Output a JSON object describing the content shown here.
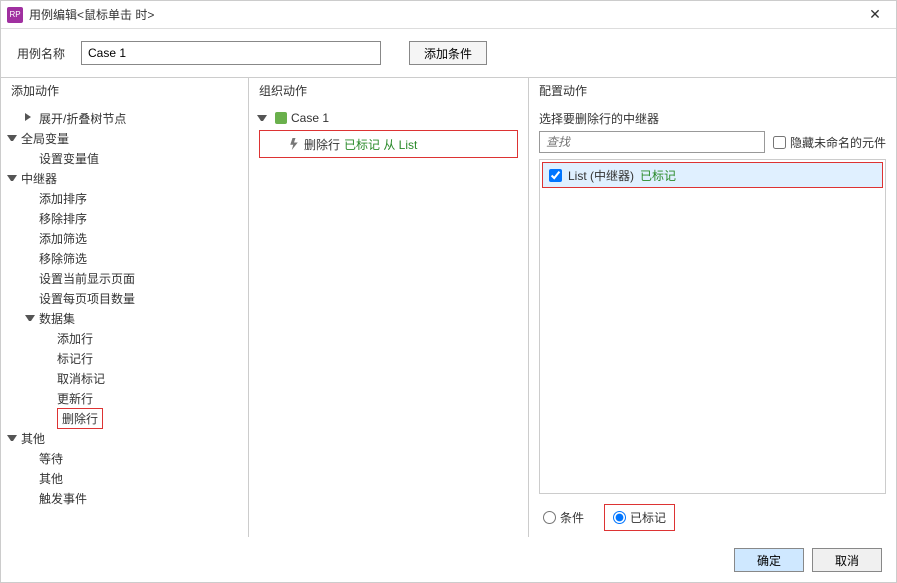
{
  "title": "用例编辑<鼠标单击 时>",
  "nameLabel": "用例名称",
  "nameValue": "Case 1",
  "addCondition": "添加条件",
  "columns": {
    "addAction": "添加动作",
    "organizeAction": "组织动作",
    "configAction": "配置动作"
  },
  "actionTree": [
    {
      "label": "展开/折叠树节点",
      "indent": 1,
      "arrow": "right"
    },
    {
      "label": "全局变量",
      "indent": 0,
      "arrow": "down"
    },
    {
      "label": "设置变量值",
      "indent": 1,
      "arrow": ""
    },
    {
      "label": "中继器",
      "indent": 0,
      "arrow": "down"
    },
    {
      "label": "添加排序",
      "indent": 1,
      "arrow": ""
    },
    {
      "label": "移除排序",
      "indent": 1,
      "arrow": ""
    },
    {
      "label": "添加筛选",
      "indent": 1,
      "arrow": ""
    },
    {
      "label": "移除筛选",
      "indent": 1,
      "arrow": ""
    },
    {
      "label": "设置当前显示页面",
      "indent": 1,
      "arrow": ""
    },
    {
      "label": "设置每页项目数量",
      "indent": 1,
      "arrow": ""
    },
    {
      "label": "数据集",
      "indent": 1,
      "arrow": "down"
    },
    {
      "label": "添加行",
      "indent": 2,
      "arrow": ""
    },
    {
      "label": "标记行",
      "indent": 2,
      "arrow": ""
    },
    {
      "label": "取消标记",
      "indent": 2,
      "arrow": ""
    },
    {
      "label": "更新行",
      "indent": 2,
      "arrow": ""
    },
    {
      "label": "删除行",
      "indent": 2,
      "arrow": "",
      "hl": true
    },
    {
      "label": "其他",
      "indent": 0,
      "arrow": "down"
    },
    {
      "label": "等待",
      "indent": 1,
      "arrow": ""
    },
    {
      "label": "其他",
      "indent": 1,
      "arrow": ""
    },
    {
      "label": "触发事件",
      "indent": 1,
      "arrow": ""
    }
  ],
  "orgCase": "Case 1",
  "orgAction": {
    "name": "删除行",
    "detail": "已标记 从 List"
  },
  "cfg": {
    "label": "选择要删除行的中继器",
    "searchPlaceholder": "查找",
    "hideUnnamed": "隐藏未命名的元件",
    "widgetName": "List (中继器)",
    "widgetStatus": "已标记",
    "radioCondition": "条件",
    "radioMarked": "已标记"
  },
  "buttons": {
    "ok": "确定",
    "cancel": "取消"
  }
}
